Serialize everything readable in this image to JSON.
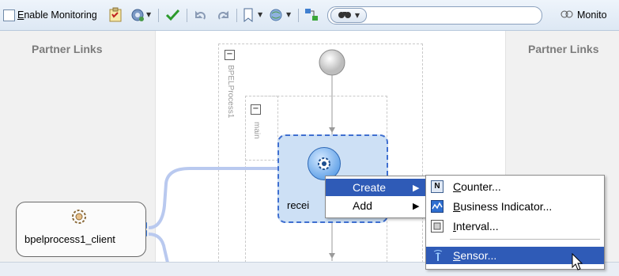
{
  "toolbar": {
    "enable_monitoring_label": "Enable Monitoring",
    "enable_monitoring_underlined": "E",
    "enable_monitoring_rest": "nable Monitoring",
    "monitor_label_partial": "Monito",
    "search_value": ""
  },
  "lanes": {
    "left_title": "Partner Links",
    "right_title": "Partner Links"
  },
  "process": {
    "outer_scope_label": "BPELProcess1",
    "inner_scope_label": "main",
    "receive_label_partial": "recei",
    "client_label": "bpelprocess1_client"
  },
  "context_menu": {
    "items": [
      {
        "label": "Create",
        "has_submenu": true
      },
      {
        "label": "Add",
        "has_submenu": true
      }
    ]
  },
  "submenu": {
    "items": [
      {
        "label": "Counter...",
        "mnemonic": "C",
        "rest": "ounter...",
        "icon": "counter-icon"
      },
      {
        "label": "Business Indicator...",
        "mnemonic": "B",
        "rest": "usiness Indicator...",
        "icon": "business-indicator-icon"
      },
      {
        "label": "Interval...",
        "mnemonic": "I",
        "rest": "nterval...",
        "icon": "interval-icon"
      },
      {
        "label": "Sensor...",
        "mnemonic": "S",
        "rest": "ensor...",
        "icon": "sensor-icon"
      }
    ],
    "counter_icon_letter": "N"
  },
  "colors": {
    "accent_blue": "#3f6fd0",
    "menu_highlight": "#2f5bb7",
    "toolbar_bg": "#e4edf7",
    "lane_bg": "#f1f1f1"
  }
}
